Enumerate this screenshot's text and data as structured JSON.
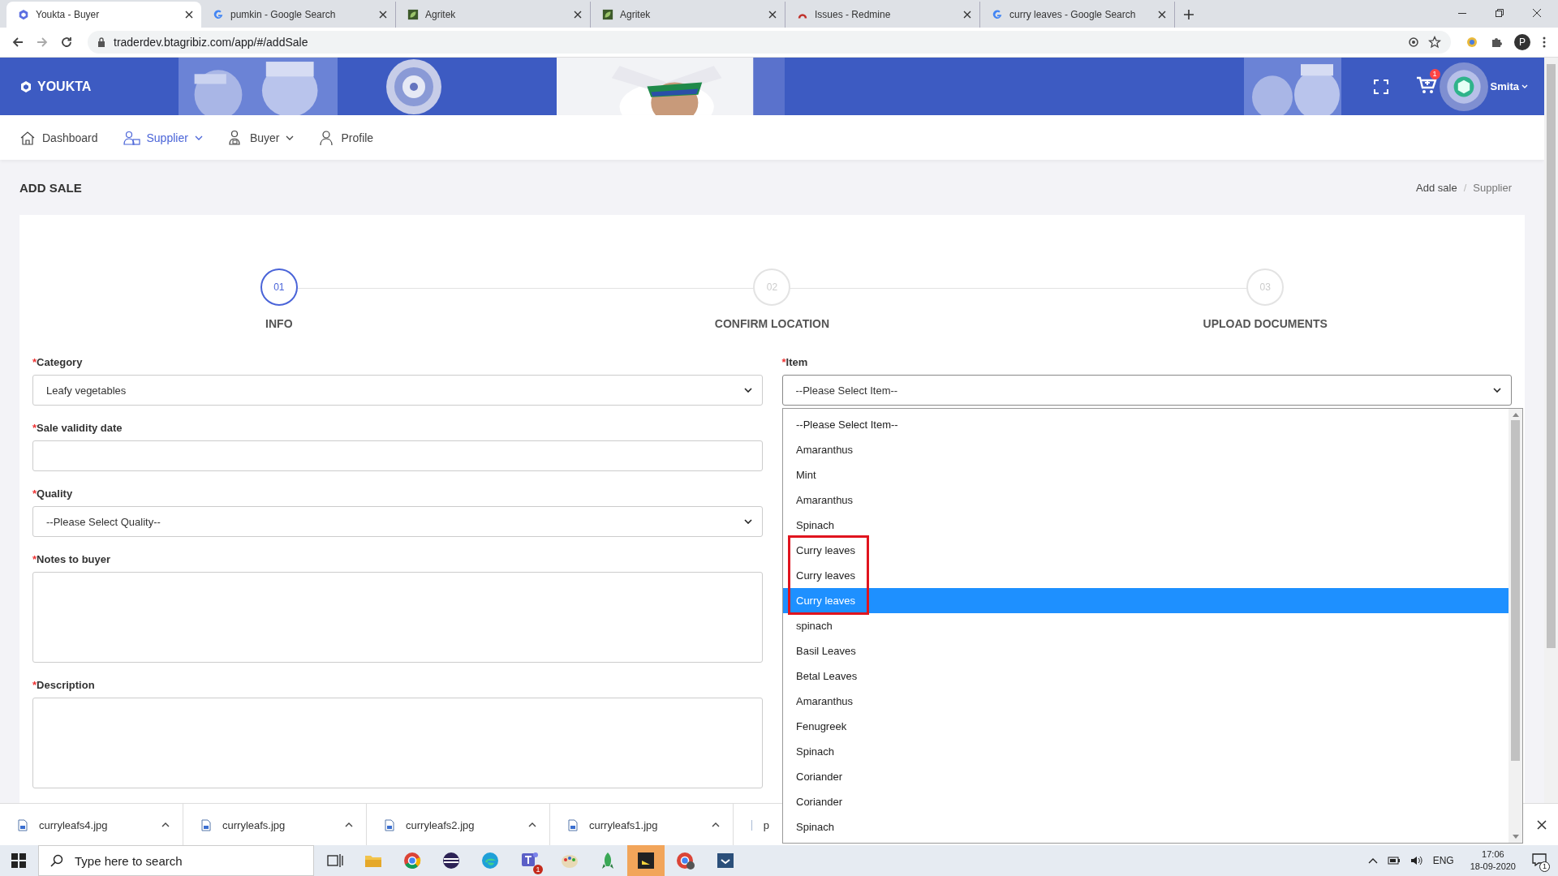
{
  "browser": {
    "tabs": [
      {
        "title": "Youkta - Buyer",
        "selected": true
      },
      {
        "title": "pumkin - Google Search",
        "selected": false
      },
      {
        "title": "Agritek",
        "selected": false
      },
      {
        "title": "Agritek",
        "selected": false
      },
      {
        "title": "Issues - Redmine",
        "selected": false
      },
      {
        "title": "curry leaves - Google Search",
        "selected": false
      }
    ],
    "url": "traderdev.btagribiz.com/app/#/addSale",
    "profile_initial": "P"
  },
  "header": {
    "brand": "YOUKTA",
    "cart_count": "1",
    "user": "Smita"
  },
  "nav": [
    {
      "label": "Dashboard",
      "caret": false,
      "selected": false
    },
    {
      "label": "Supplier",
      "caret": true,
      "selected": true
    },
    {
      "label": "Buyer",
      "caret": true,
      "selected": false
    },
    {
      "label": "Profile",
      "caret": false,
      "selected": false
    }
  ],
  "page_title": "ADD SALE",
  "breadcrumb": [
    "Add sale",
    "/",
    "Supplier"
  ],
  "steps": [
    {
      "number": "01",
      "label": "INFO",
      "selected": true
    },
    {
      "number": "02",
      "label": "CONFIRM LOCATION",
      "selected": false
    },
    {
      "number": "03",
      "label": "UPLOAD DOCUMENTS",
      "selected": false
    }
  ],
  "left_fields": [
    {
      "marker": "*",
      "label": "Category",
      "kind": "select",
      "value": "Leafy vegetables"
    },
    {
      "marker": "*",
      "label": "Sale validity date",
      "kind": "input"
    },
    {
      "marker": "*",
      "label": "Quality",
      "kind": "select",
      "value": "--Please Select Quality--"
    },
    {
      "marker": "*",
      "label": "Notes to buyer",
      "kind": "textarea"
    },
    {
      "marker": "*",
      "label": "Description",
      "kind": "textarea"
    }
  ],
  "item_field": {
    "marker": "*",
    "label": "Item",
    "value": "--Please Select Item--"
  },
  "item_options": [
    {
      "label": "--Please Select Item--",
      "selected": false,
      "boxed": false
    },
    {
      "label": "Amaranthus",
      "selected": false,
      "boxed": false
    },
    {
      "label": "Mint",
      "selected": false,
      "boxed": false
    },
    {
      "label": "Amaranthus",
      "selected": false,
      "boxed": false
    },
    {
      "label": "Spinach",
      "selected": false,
      "boxed": false
    },
    {
      "label": "Curry leaves",
      "selected": false,
      "boxed": true
    },
    {
      "label": "Curry leaves",
      "selected": false,
      "boxed": true
    },
    {
      "label": "Curry leaves",
      "selected": true,
      "boxed": true
    },
    {
      "label": "spinach",
      "selected": false,
      "boxed": false
    },
    {
      "label": "Basil Leaves",
      "selected": false,
      "boxed": false
    },
    {
      "label": "Betal Leaves",
      "selected": false,
      "boxed": false
    },
    {
      "label": "Amaranthus",
      "selected": false,
      "boxed": false
    },
    {
      "label": "Fenugreek",
      "selected": false,
      "boxed": false
    },
    {
      "label": "Spinach",
      "selected": false,
      "boxed": false
    },
    {
      "label": "Coriander",
      "selected": false,
      "boxed": false
    },
    {
      "label": "Coriander",
      "selected": false,
      "boxed": false
    },
    {
      "label": "Spinach",
      "selected": false,
      "boxed": false
    }
  ],
  "downloads": [
    "curryleafs4.jpg",
    "curryleafs.jpg",
    "curryleafs2.jpg",
    "curryleafs1.jpg",
    "p"
  ],
  "taskbar": {
    "search_placeholder": "Type here to search",
    "teams_badge": "1",
    "language": "ENG",
    "time": "17:06",
    "date": "18-09-2020",
    "notifications": "1"
  }
}
